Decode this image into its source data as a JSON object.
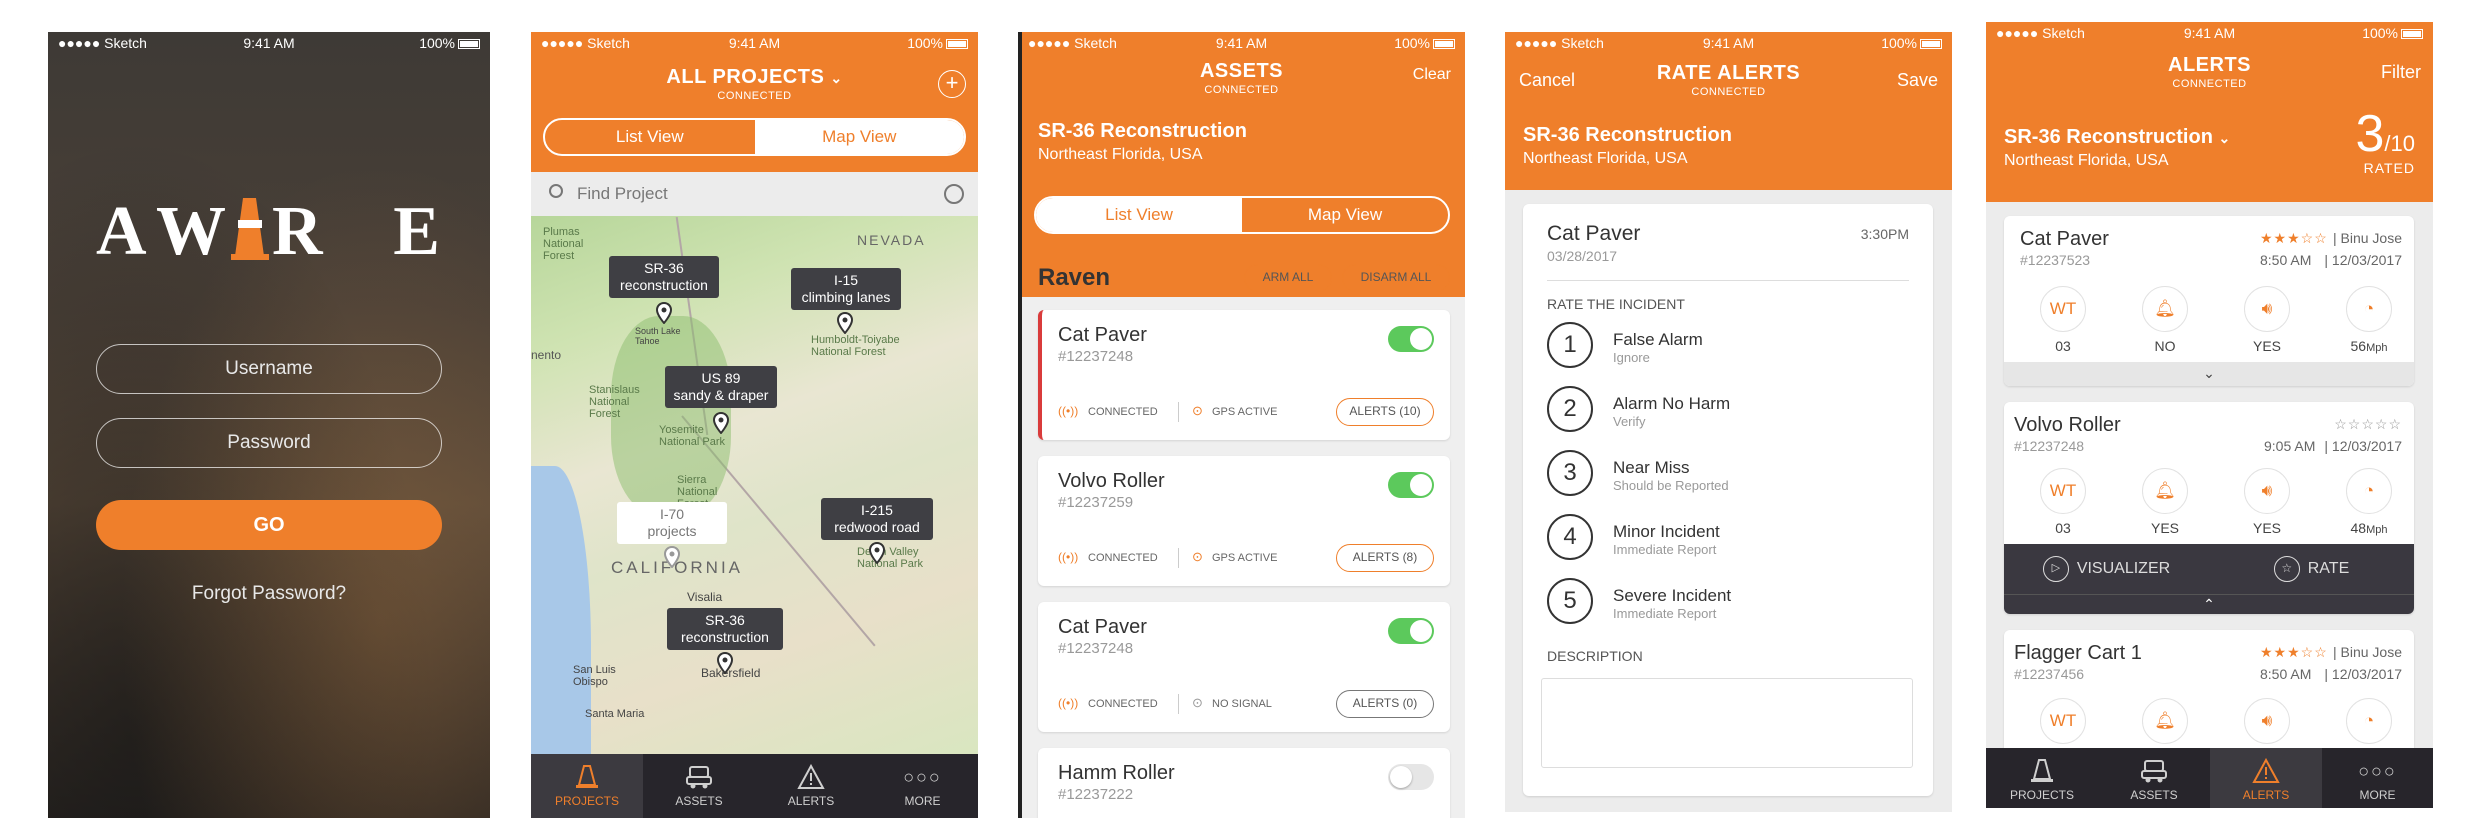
{
  "status": {
    "carrier": "●●●●● Sketch",
    "time": "9:41 AM",
    "battery": "100%"
  },
  "login": {
    "logo": "AWARE",
    "username_placeholder": "Username",
    "password_placeholder": "Password",
    "go": "GO",
    "forgot": "Forgot Password?"
  },
  "projects": {
    "title": "ALL PROJECTS",
    "connected": "CONNECTED",
    "list_view": "List View",
    "map_view": "Map View",
    "search_placeholder": "Find Project",
    "map_labels": {
      "plumas": "Plumas National Forest",
      "nevada": "NEVADA",
      "humboldt": "Humboldt-Toiyabe National Forest",
      "sacramento": "nento",
      "stanislaus": "Stanislaus National Forest",
      "yosemite": "Yosemite National Park",
      "sierra": "Sierra National Forest",
      "california": "CALIFORNIA",
      "visalia": "Visalia",
      "bakersfield": "Bakersfield",
      "sanluis": "San Luis Obispo",
      "santamaria": "Santa Maria",
      "deathvalley": "Death Valley National Park",
      "southlake": "South Lake Tahoe"
    },
    "pins": [
      {
        "line1": "SR-36",
        "line2": "reconstruction"
      },
      {
        "line1": "I-15",
        "line2": "climbing lanes"
      },
      {
        "line1": "US 89",
        "line2": "sandy & draper"
      },
      {
        "line1": "I-215",
        "line2": "redwood road"
      },
      {
        "line1": "I-70",
        "line2": "projects"
      },
      {
        "line1": "SR-36",
        "line2": "reconstruction"
      }
    ]
  },
  "tabs": {
    "projects": "PROJECTS",
    "assets": "ASSETS",
    "alerts": "ALERTS",
    "more": "MORE"
  },
  "assets": {
    "title": "ASSETS",
    "connected": "CONNECTED",
    "clear": "Clear",
    "project": "SR-36 Reconstruction",
    "location": "Northeast Florida, USA",
    "list_view": "List View",
    "map_view": "Map View",
    "group": "Raven",
    "arm_all": "ARM ALL",
    "disarm_all": "DISARM ALL",
    "items": [
      {
        "name": "Cat Paver",
        "id": "#12237248",
        "conn": "CONNECTED",
        "gps": "GPS ACTIVE",
        "alerts": "ALERTS (10)"
      },
      {
        "name": "Volvo Roller",
        "id": "#12237259",
        "conn": "CONNECTED",
        "gps": "GPS ACTIVE",
        "alerts": "ALERTS (8)"
      },
      {
        "name": "Cat Paver",
        "id": "#12237248",
        "conn": "CONNECTED",
        "gps": "NO SIGNAL",
        "alerts": "ALERTS (0)"
      },
      {
        "name": "Hamm Roller",
        "id": "#12237222"
      }
    ]
  },
  "rate": {
    "cancel": "Cancel",
    "title": "RATE ALERTS",
    "connected": "CONNECTED",
    "save": "Save",
    "project": "SR-36 Reconstruction",
    "location": "Northeast Florida, USA",
    "asset": "Cat Paver",
    "date": "03/28/2017",
    "time": "3:30PM",
    "section": "RATE THE INCIDENT",
    "description": "DESCRIPTION",
    "options": [
      {
        "n": "1",
        "title": "False Alarm",
        "sub": "Ignore"
      },
      {
        "n": "2",
        "title": "Alarm No Harm",
        "sub": "Verify"
      },
      {
        "n": "3",
        "title": "Near Miss",
        "sub": "Should be Reported"
      },
      {
        "n": "4",
        "title": "Minor Incident",
        "sub": "Immediate Report"
      },
      {
        "n": "5",
        "title": "Severe Incident",
        "sub": "Immediate Report"
      }
    ]
  },
  "alerts": {
    "title": "ALERTS",
    "connected": "CONNECTED",
    "filter": "Filter",
    "project": "SR-36 Reconstruction",
    "location": "Northeast Florida, USA",
    "rated_num": "3",
    "rated_den": "/10",
    "rated": "RATED",
    "visualizer": "VISUALIZER",
    "rate": "RATE",
    "items": [
      {
        "name": "Cat Paver",
        "id": "#12237523",
        "person": "Binu Jose",
        "time": "8:50 AM",
        "date": "12/03/2017",
        "wt": "03",
        "v2": "NO",
        "v3": "YES",
        "v4": "56",
        "unit": "Mph",
        "rating": 3
      },
      {
        "name": "Volvo Roller",
        "id": "#12237248",
        "person": "",
        "time": "9:05 AM",
        "date": "12/03/2017",
        "wt": "03",
        "v2": "YES",
        "v3": "YES",
        "v4": "48",
        "unit": "Mph",
        "rating": 0
      },
      {
        "name": "Flagger Cart 1",
        "id": "#12237456",
        "person": "Binu Jose",
        "time": "8:50 AM",
        "date": "12/03/2017",
        "rating": 3
      }
    ],
    "wt": "WT"
  },
  "colors": {
    "accent": "#ef7f2b",
    "dark": "#27252b",
    "green": "#5cc95c"
  }
}
